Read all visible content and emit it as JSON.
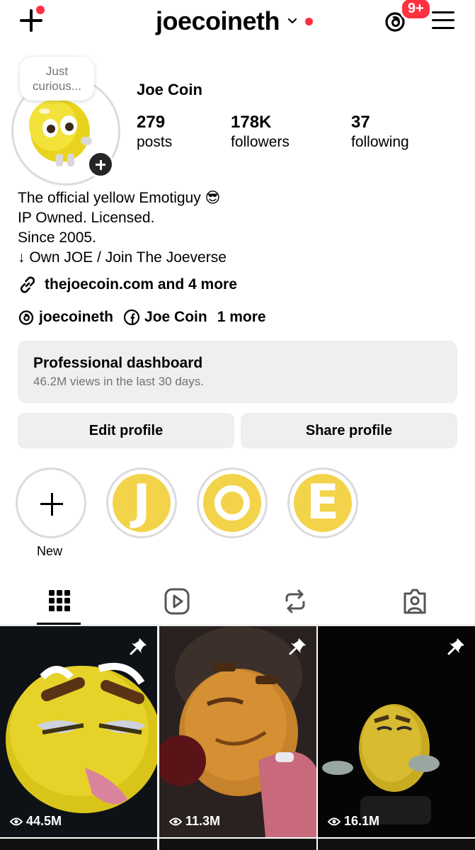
{
  "header": {
    "username": "joecoineth",
    "notification_badge": "9+"
  },
  "profile": {
    "note": [
      "Just",
      "curious..."
    ],
    "display_name": "Joe Coin",
    "stats": [
      {
        "value": "279",
        "label": "posts"
      },
      {
        "value": "178K",
        "label": "followers"
      },
      {
        "value": "37",
        "label": "following"
      }
    ],
    "bio": [
      "The official yellow Emotiguy 😎",
      "IP Owned. Licensed.",
      "Since 2005.",
      "↓ Own JOE / Join The Joeverse"
    ],
    "link_text": "thejoecoin.com and 4 more",
    "threads_handle": "joecoineth",
    "facebook_name": "Joe Coin",
    "more_links": "1 more"
  },
  "dashboard": {
    "title": "Professional dashboard",
    "subtitle": "46.2M views in the last 30 days."
  },
  "actions": {
    "edit_label": "Edit profile",
    "share_label": "Share profile"
  },
  "highlights": [
    {
      "label": "New",
      "letter": ""
    },
    {
      "label": "",
      "letter": "J"
    },
    {
      "label": "",
      "letter": "O"
    },
    {
      "label": "",
      "letter": "E"
    }
  ],
  "tabs": [
    "grid-icon",
    "reels-icon",
    "reposts-icon",
    "tagged-icon"
  ],
  "posts": [
    {
      "views": "44.5M",
      "pinned": true
    },
    {
      "views": "11.3M",
      "pinned": true
    },
    {
      "views": "16.1M",
      "pinned": true
    }
  ],
  "colors": {
    "accent_red": "#ff3040",
    "highlight_yellow": "#f3d34a",
    "button_gray": "#efeff1"
  }
}
